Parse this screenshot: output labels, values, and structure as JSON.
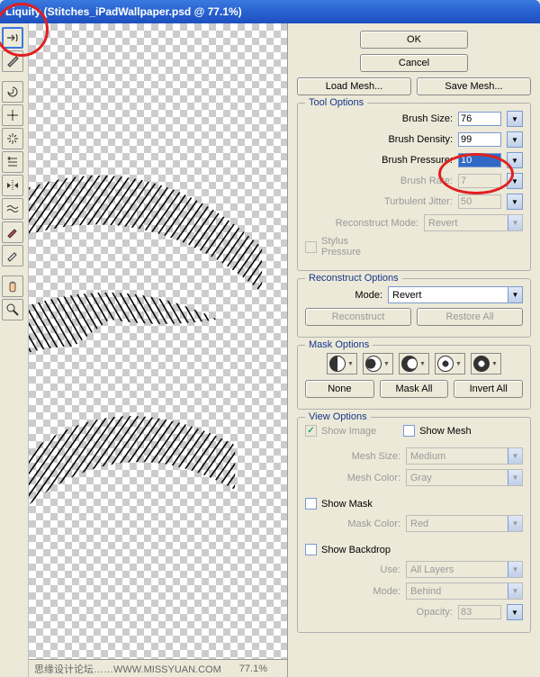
{
  "titlebar": {
    "text": "Liquify (Stitches_iPadWallpaper.psd @ 77.1%)"
  },
  "buttons": {
    "ok": "OK",
    "cancel": "Cancel",
    "load_mesh": "Load Mesh...",
    "save_mesh": "Save Mesh...",
    "reconstruct": "Reconstruct",
    "restore_all": "Restore All",
    "none": "None",
    "mask_all": "Mask All",
    "invert_all": "Invert All"
  },
  "tool_options": {
    "legend": "Tool Options",
    "brush_size": {
      "label": "Brush Size:",
      "value": "76"
    },
    "brush_density": {
      "label": "Brush Density:",
      "value": "99"
    },
    "brush_pressure": {
      "label": "Brush Pressure:",
      "value": "10"
    },
    "brush_rate": {
      "label": "Brush Rate:",
      "value": "7"
    },
    "turbulent_jitter": {
      "label": "Turbulent Jitter:",
      "value": "50"
    },
    "reconstruct_mode": {
      "label": "Reconstruct Mode:",
      "value": "Revert"
    },
    "stylus_pressure": "Stylus Pressure"
  },
  "reconstruct_options": {
    "legend": "Reconstruct Options",
    "mode": {
      "label": "Mode:",
      "value": "Revert"
    }
  },
  "mask_options": {
    "legend": "Mask Options"
  },
  "view_options": {
    "legend": "View Options",
    "show_image": "Show Image",
    "show_mesh": "Show Mesh",
    "mesh_size": {
      "label": "Mesh Size:",
      "value": "Medium"
    },
    "mesh_color": {
      "label": "Mesh Color:",
      "value": "Gray"
    },
    "show_mask": "Show Mask",
    "mask_color": {
      "label": "Mask Color:",
      "value": "Red"
    },
    "show_backdrop": "Show Backdrop",
    "use": {
      "label": "Use:",
      "value": "All Layers"
    },
    "mode": {
      "label": "Mode:",
      "value": "Behind"
    },
    "opacity": {
      "label": "Opacity:",
      "value": "83"
    }
  },
  "status": {
    "left": "思缘设计论坛……WWW.MISSYUAN.COM",
    "zoom": "77.1%"
  },
  "tools": [
    "forward-warp-tool",
    "reconstruct-tool",
    "twirl-tool",
    "pucker-tool",
    "bloat-tool",
    "push-left-tool",
    "mirror-tool",
    "turbulence-tool",
    "freeze-mask-tool",
    "thaw-mask-tool",
    "hand-tool",
    "zoom-tool"
  ]
}
